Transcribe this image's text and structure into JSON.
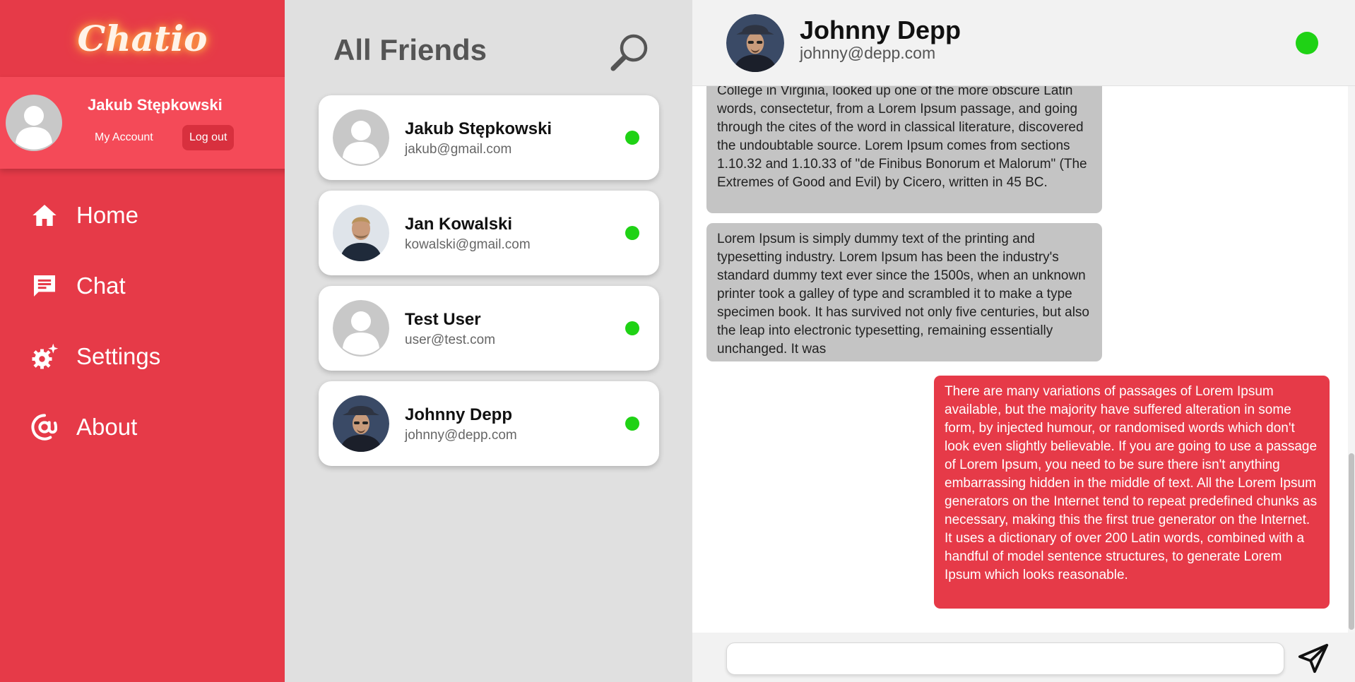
{
  "app": {
    "logo": "Chatio"
  },
  "profile": {
    "name": "Jakub Stępkowski",
    "my_account_label": "My Account",
    "logout_label": "Log out",
    "avatar_icon": "default-avatar-icon"
  },
  "nav": {
    "items": [
      {
        "label": "Home",
        "icon": "home-icon"
      },
      {
        "label": "Chat",
        "icon": "chat-icon"
      },
      {
        "label": "Settings",
        "icon": "settings-icon"
      },
      {
        "label": "About",
        "icon": "at-sign-icon"
      }
    ]
  },
  "friends": {
    "title": "All Friends",
    "search_icon": "search-icon",
    "list": [
      {
        "name": "Jakub Stępkowski",
        "email": "jakub@gmail.com",
        "avatar": "default-avatar-icon",
        "status": "online"
      },
      {
        "name": "Jan Kowalski",
        "email": "kowalski@gmail.com",
        "avatar": "photo-avatar",
        "status": "online"
      },
      {
        "name": "Test User",
        "email": "user@test.com",
        "avatar": "default-avatar-icon",
        "status": "online"
      },
      {
        "name": "Johnny Depp",
        "email": "johnny@depp.com",
        "avatar": "photo-avatar",
        "status": "online"
      }
    ]
  },
  "chat": {
    "header": {
      "name": "Johnny Depp",
      "email": "johnny@depp.com",
      "status": "online"
    },
    "messages": [
      {
        "direction": "incoming",
        "text": "College in Virginia, looked up one of the more obscure Latin words, consectetur, from a Lorem Ipsum passage, and going through the cites of the word in classical literature, discovered the undoubtable source. Lorem Ipsum comes from sections 1.10.32 and 1.10.33 of \"de Finibus Bonorum et Malorum\" (The Extremes of Good and Evil) by Cicero, written in 45 BC."
      },
      {
        "direction": "incoming",
        "text": "Lorem Ipsum is simply dummy text of the printing and typesetting industry. Lorem Ipsum has been the industry's standard dummy text ever since the 1500s, when an unknown printer took a galley of type and scrambled it to make a type specimen book. It has survived not only five centuries, but also the leap into electronic typesetting, remaining essentially unchanged. It was"
      },
      {
        "direction": "outgoing",
        "text": "There are many variations of passages of Lorem Ipsum available, but the majority have suffered alteration in some form, by injected humour, or randomised words which don't look even slightly believable. If you are going to use a passage of Lorem Ipsum, you need to be sure there isn't anything embarrassing hidden in the middle of text. All the Lorem Ipsum generators on the Internet tend to repeat predefined chunks as necessary, making this the first true generator on the Internet. It uses a dictionary of over 200 Latin words, combined with a handful of model sentence structures, to generate Lorem Ipsum which looks reasonable."
      }
    ],
    "composer": {
      "value": "",
      "placeholder": "",
      "send_icon": "send-icon"
    }
  },
  "colors": {
    "brand_red": "#e63a48",
    "profile_red": "#f44a58",
    "online_green": "#1fd215",
    "incoming_bubble": "#c4c4c4",
    "panel_gray": "#e0e0e0"
  }
}
